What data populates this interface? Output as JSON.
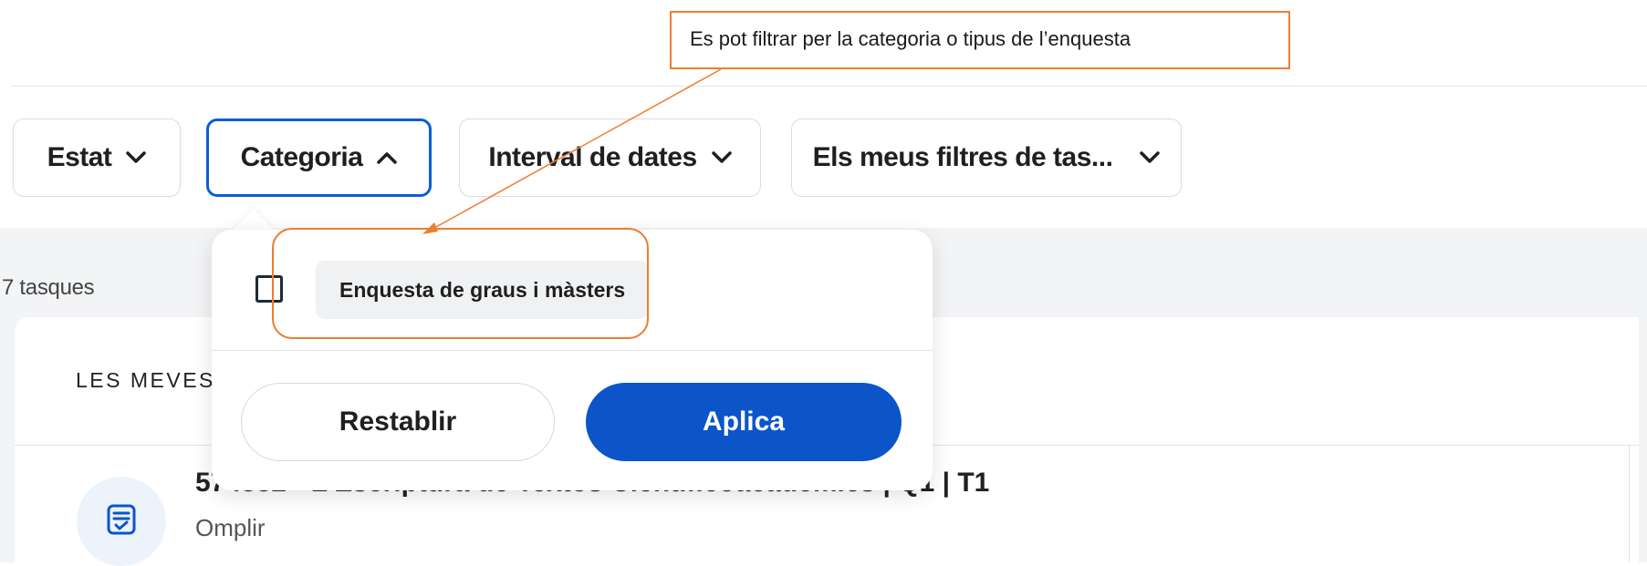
{
  "filters": {
    "status_label": "Estat",
    "category_label": "Categoria",
    "date_range_label": "Interval de dates",
    "my_filters_label": "Els meus filtres de tas..."
  },
  "task_count": "7 tasques",
  "card": {
    "title": "LES MEVES",
    "task": {
      "name": "574552 - L'Escriptura de Textos Científicoacadèmics | Q1 | T1",
      "action": "Omplir"
    }
  },
  "popover": {
    "option_label": "Enquesta de graus i màsters",
    "reset_label": "Restablir",
    "apply_label": "Aplica"
  },
  "annotation": {
    "callout_text": "Es pot filtrar per la categoria o tipus de l’enquesta",
    "color": "#ed7d31"
  },
  "colors": {
    "accent": "#0b55c9",
    "active_border": "#0b5ed7"
  },
  "icons": {
    "chevron_down": "chevron-down-icon",
    "chevron_up": "chevron-up-icon",
    "task": "form-check-icon"
  }
}
